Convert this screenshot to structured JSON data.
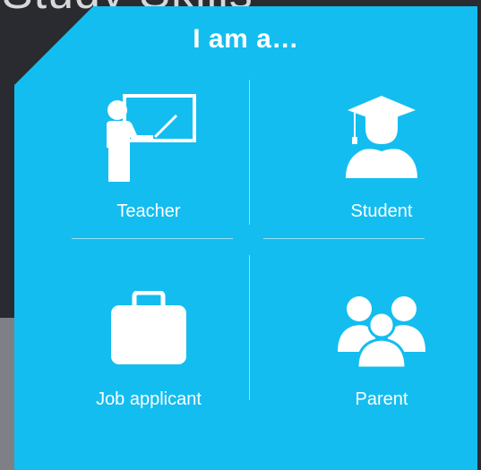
{
  "background": {
    "title": "Study Skills"
  },
  "panel": {
    "heading": "I am a…",
    "accent_color": "#13bdf0"
  },
  "options": [
    {
      "label": "Teacher",
      "icon": "teacher-icon"
    },
    {
      "label": "Student",
      "icon": "graduate-icon"
    },
    {
      "label": "Job applicant",
      "icon": "briefcase-icon"
    },
    {
      "label": "Parent",
      "icon": "family-icon"
    }
  ]
}
